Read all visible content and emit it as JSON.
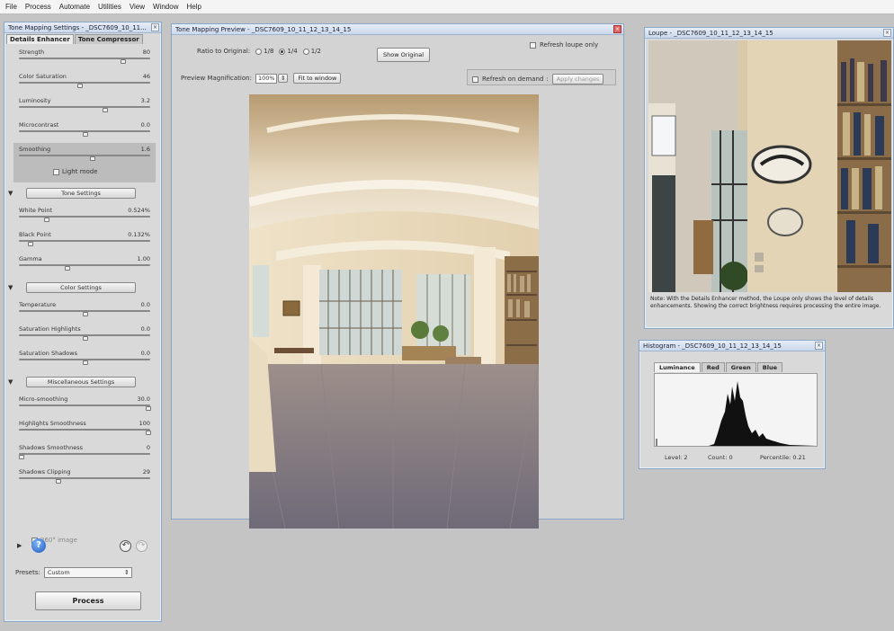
{
  "menubar": [
    "File",
    "Process",
    "Automate",
    "Utilities",
    "View",
    "Window",
    "Help"
  ],
  "settings": {
    "title": "Tone Mapping Settings - _DSC7609_10_11...",
    "tabs": [
      "Details Enhancer",
      "Tone Compressor"
    ],
    "sliders_top": [
      {
        "label": "Strength",
        "value": "80",
        "pos": 0.8
      },
      {
        "label": "Color Saturation",
        "value": "46",
        "pos": 0.46
      },
      {
        "label": "Luminosity",
        "value": "3.2",
        "pos": 0.66
      },
      {
        "label": "Microcontrast",
        "value": "0.0",
        "pos": 0.5
      }
    ],
    "smoothing": {
      "label": "Smoothing",
      "value": "1.6",
      "pos": 0.56
    },
    "light_mode": "Light mode",
    "tone_section": "Tone Settings",
    "tone_sliders": [
      {
        "label": "White Point",
        "value": "0.524%",
        "pos": 0.2
      },
      {
        "label": "Black Point",
        "value": "0.132%",
        "pos": 0.07
      },
      {
        "label": "Gamma",
        "value": "1.00",
        "pos": 0.36
      }
    ],
    "color_section": "Color Settings",
    "color_sliders": [
      {
        "label": "Temperature",
        "value": "0.0",
        "pos": 0.5
      },
      {
        "label": "Saturation Highlights",
        "value": "0.0",
        "pos": 0.5
      },
      {
        "label": "Saturation Shadows",
        "value": "0.0",
        "pos": 0.5
      }
    ],
    "misc_section": "Miscellaneous Settings",
    "misc_sliders": [
      {
        "label": "Micro-smoothing",
        "value": "30.0",
        "pos": 1.0
      },
      {
        "label": "Highlights Smoothness",
        "value": "100",
        "pos": 1.0
      },
      {
        "label": "Shadows Smoothness",
        "value": "0",
        "pos": 0.0
      },
      {
        "label": "Shadows Clipping",
        "value": "29",
        "pos": 0.29
      }
    ],
    "pano": "360° image",
    "presets_label": "Presets:",
    "preset_value": "Custom",
    "process": "Process",
    "help": "?"
  },
  "preview": {
    "title": "Tone Mapping Preview - _DSC7609_10_11_12_13_14_15",
    "ratio_label": "Ratio to Original:",
    "ratios": [
      "1/8",
      "1/4",
      "1/2"
    ],
    "selected_ratio": "1/4",
    "show_original": "Show Original",
    "refresh_loupe": "Refresh loupe only",
    "mag_label": "Preview Magnification:",
    "mag_value": "100%",
    "fit": "Fit to window",
    "refresh_demand": "Refresh on demand",
    "apply": "Apply changes"
  },
  "loupe": {
    "title": "Loupe - _DSC7609_10_11_12_13_14_15",
    "note": "Note: With the Details Enhancer method, the Loupe only shows the level of details enhancements. Showing the correct brightness requires processing the entire image."
  },
  "histogram": {
    "title": "Histogram - _DSC7609_10_11_12_13_14_15",
    "tabs": [
      "Luminance",
      "Red",
      "Green",
      "Blue"
    ],
    "level": "Level: 2",
    "count": "Count: 0",
    "percentile": "Percentile: 0.21"
  }
}
